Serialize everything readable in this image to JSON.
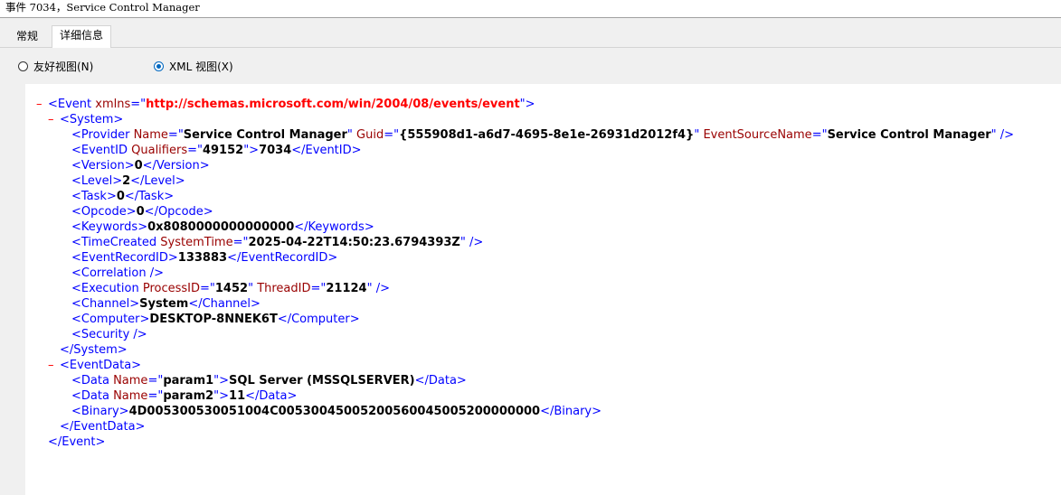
{
  "window": {
    "title": "事件 7034，Service Control Manager"
  },
  "tabs": [
    {
      "label": "常规",
      "active": false
    },
    {
      "label": "详细信息",
      "active": true
    }
  ],
  "view_options": [
    {
      "label": "友好视图(N)",
      "selected": false
    },
    {
      "label": "XML 视图(X)",
      "selected": true
    }
  ],
  "xml": {
    "event_ns": "http://schemas.microsoft.com/win/2004/08/events/event",
    "provider_name": "Service Control Manager",
    "provider_guid": "{555908d1-a6d7-4695-8e1e-26931d2012f4}",
    "event_source_name": "Service Control Manager",
    "event_id_qualifiers": "49152",
    "event_id": "7034",
    "version": "0",
    "level": "2",
    "task": "0",
    "opcode": "0",
    "keywords": "0x8080000000000000",
    "time_created": "2025-04-22T14:50:23.6794393Z",
    "event_record_id": "133883",
    "process_id": "1452",
    "thread_id": "21124",
    "channel": "System",
    "computer": "DESKTOP-8NNEK6T",
    "param1_name": "param1",
    "param1_value": "SQL Server (MSSQLSERVER)",
    "param2_name": "param2",
    "param2_value": "11",
    "binary": "4D005300530051004C00530045005200560045005200000000"
  },
  "colors": {
    "tag": "#0000ff",
    "attr_name": "#990000",
    "namespace": "#ff0000",
    "collapse": "#ff0000",
    "radio_accent": "#0067c0"
  }
}
